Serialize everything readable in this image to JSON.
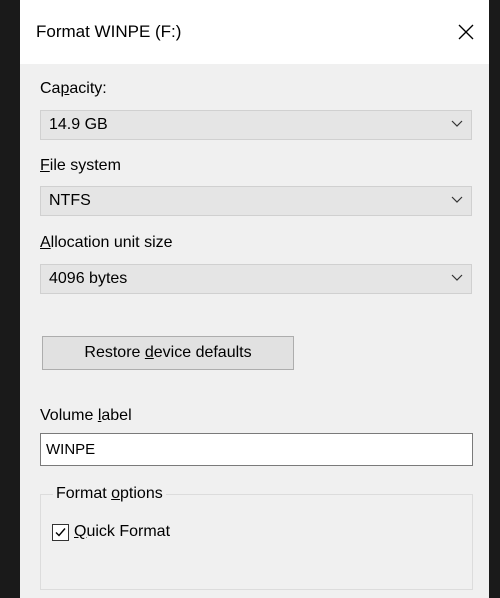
{
  "window": {
    "title": "Format WINPE (F:)"
  },
  "capacity": {
    "label_pre": "Ca",
    "label_accel": "p",
    "label_post": "acity:",
    "value": "14.9 GB"
  },
  "file_system": {
    "label_accel": "F",
    "label_post": "ile system",
    "value": "NTFS"
  },
  "allocation": {
    "label_accel": "A",
    "label_post": "llocation unit size",
    "value": "4096 bytes"
  },
  "restore_button": {
    "label_pre": "Restore ",
    "label_accel": "d",
    "label_post": "evice defaults"
  },
  "volume_label": {
    "label_pre": "Volume ",
    "label_accel": "l",
    "label_post": "abel",
    "value": "WINPE"
  },
  "format_options": {
    "title_pre": "Format ",
    "title_accel": "o",
    "title_post": "ptions",
    "quick_format": {
      "label_accel": "Q",
      "label_post": "uick Format",
      "checked": true
    }
  },
  "icons": {
    "close": "close-icon",
    "dropdown": "chevron-down-icon",
    "check": "checkmark-icon"
  }
}
